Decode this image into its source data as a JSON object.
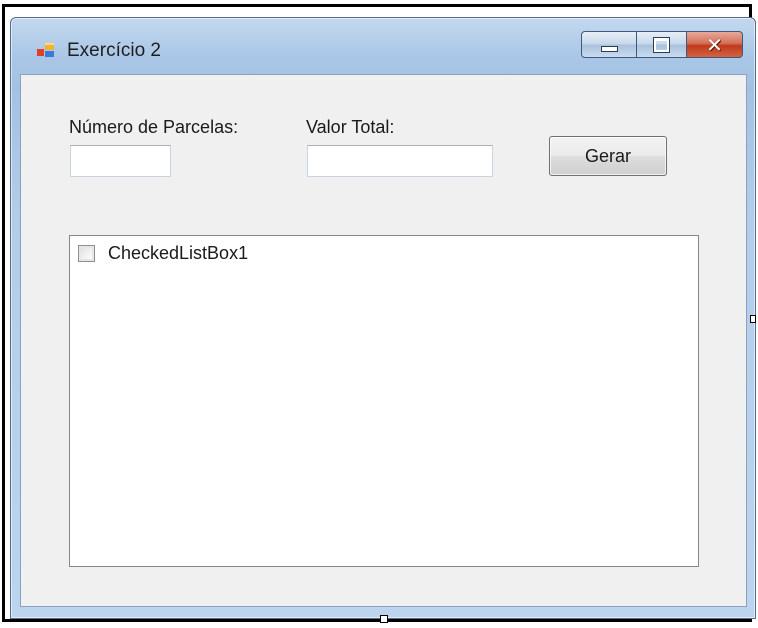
{
  "window": {
    "title": "Exercício 2",
    "icon": "windows-form-icon"
  },
  "caption": {
    "minimize_icon": "minimize-icon",
    "maximize_icon": "maximize-icon",
    "close_icon": "close-icon",
    "close_glyph": "✕"
  },
  "form": {
    "parcelas_label": "Número de Parcelas:",
    "parcelas_value": "",
    "valor_label": "Valor Total:",
    "valor_value": "",
    "gerar_button": "Gerar",
    "list": {
      "items": [
        {
          "label": "CheckedListBox1",
          "checked": false
        }
      ]
    }
  },
  "colors": {
    "client_background": "#f0f0f0",
    "close_button": "#c03a1c",
    "frame": "#a9c6e6"
  }
}
